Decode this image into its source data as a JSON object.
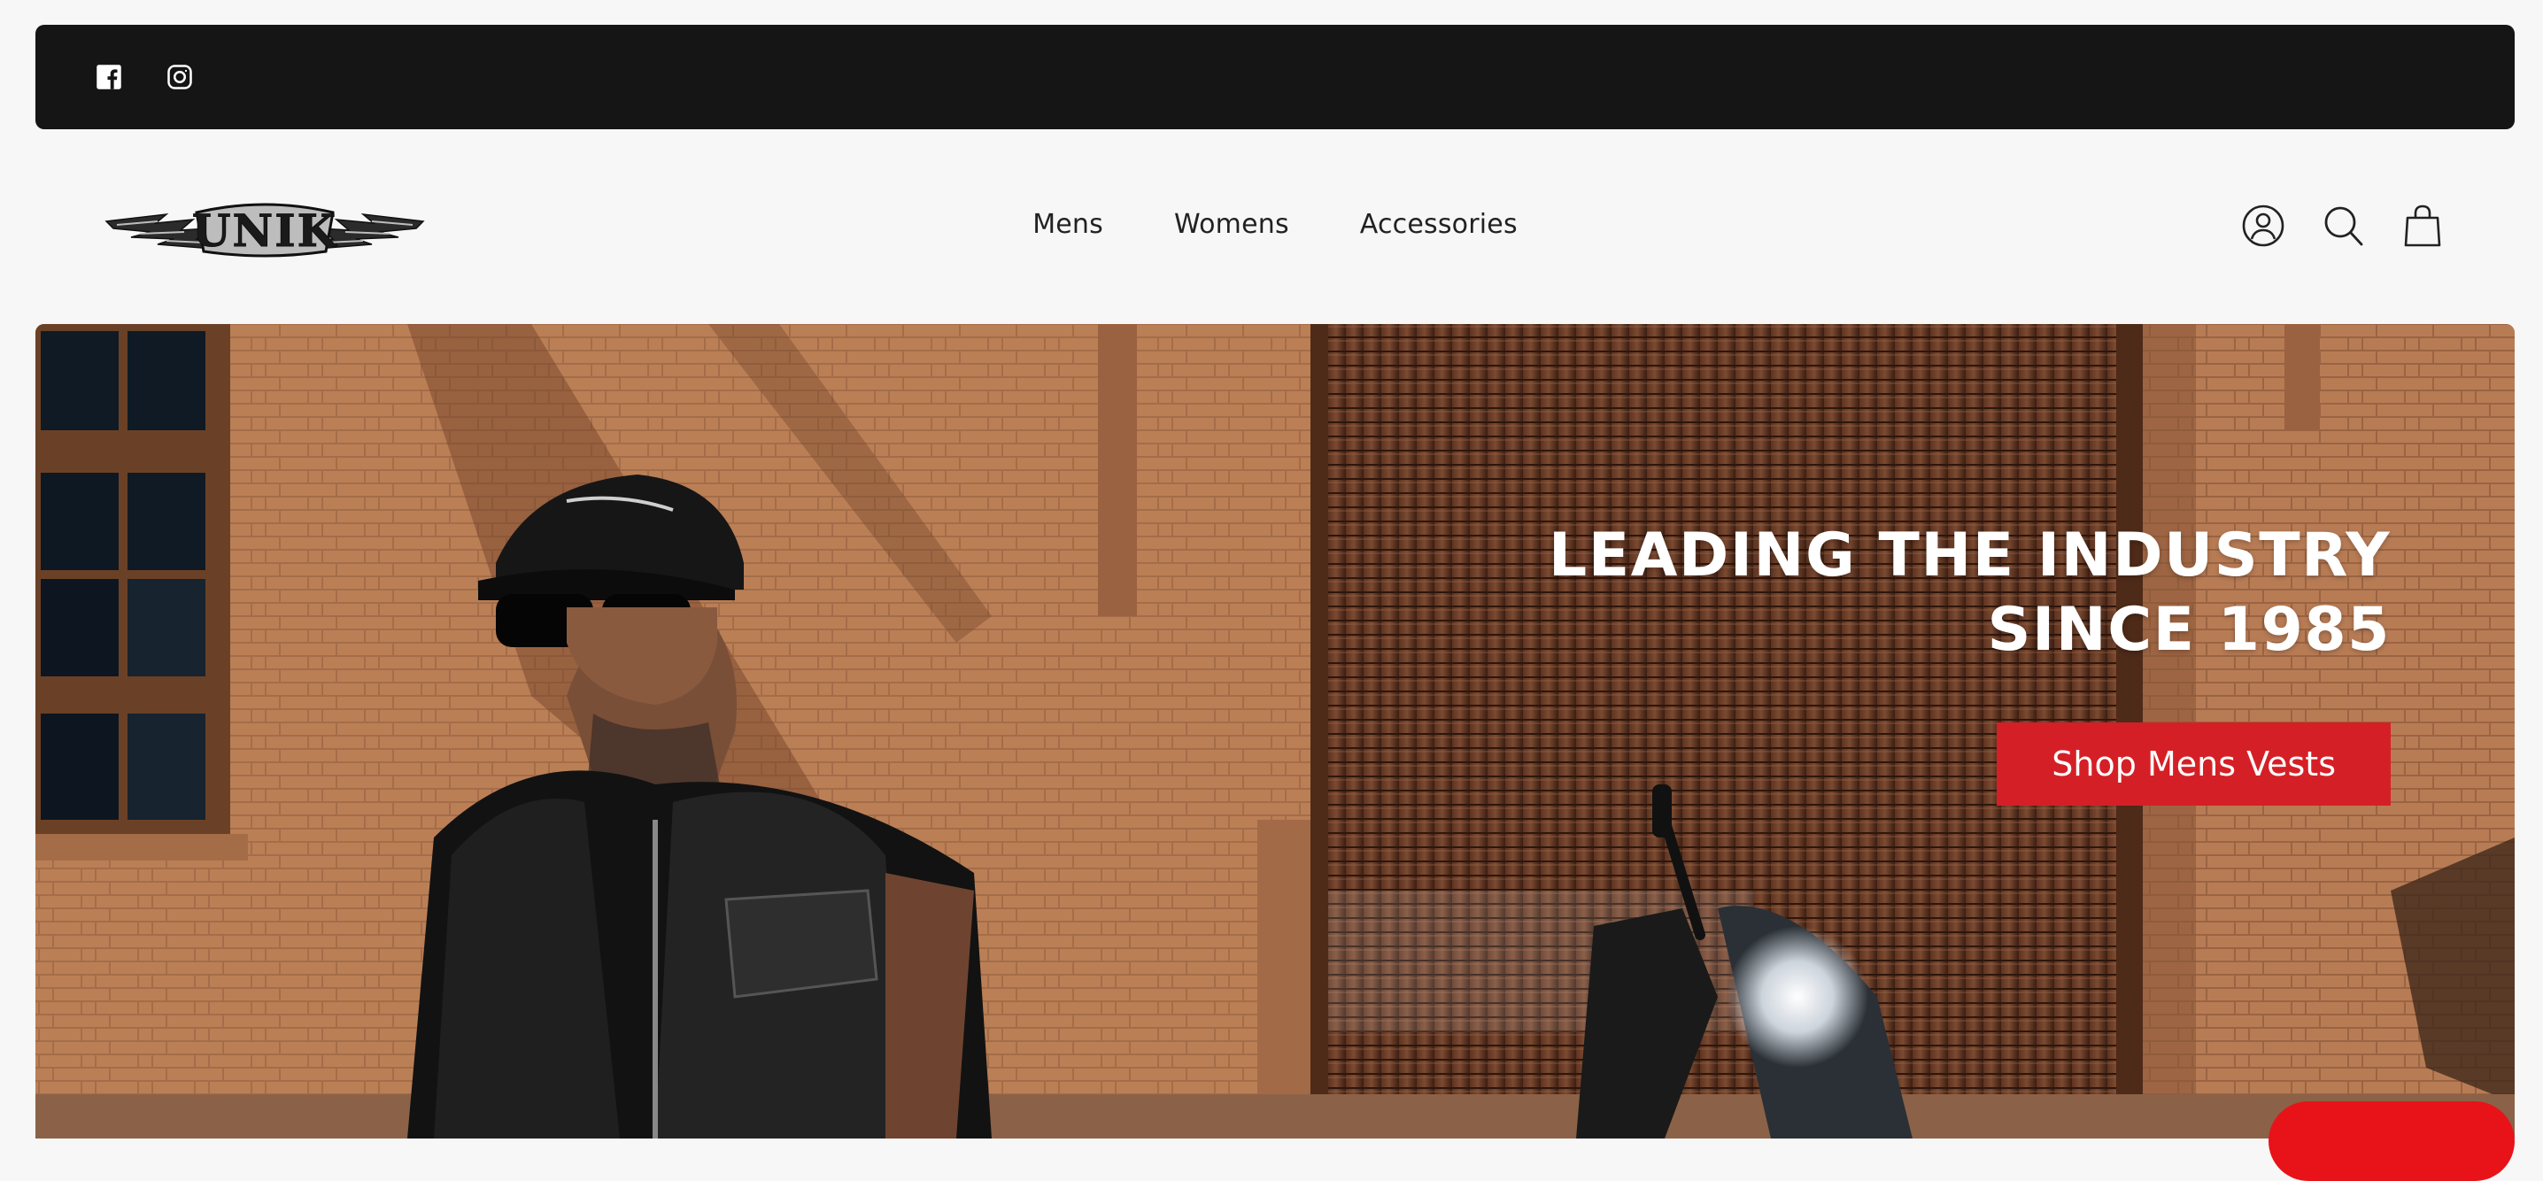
{
  "announcement_bar": {
    "icons": [
      "facebook-icon",
      "instagram-icon"
    ],
    "background": "#151515"
  },
  "header": {
    "logo_text": "UNIK",
    "nav": [
      {
        "label": "Mens"
      },
      {
        "label": "Womens"
      },
      {
        "label": "Accessories"
      }
    ],
    "icons": [
      "account-icon",
      "search-icon",
      "cart-icon"
    ]
  },
  "hero": {
    "heading_line1": "LEADING THE INDUSTRY",
    "heading_line2": "SINCE 1985",
    "cta_label": "Shop Mens Vests",
    "cta_color": "#d51f26"
  },
  "chat_widget": {
    "color": "#e81319"
  }
}
